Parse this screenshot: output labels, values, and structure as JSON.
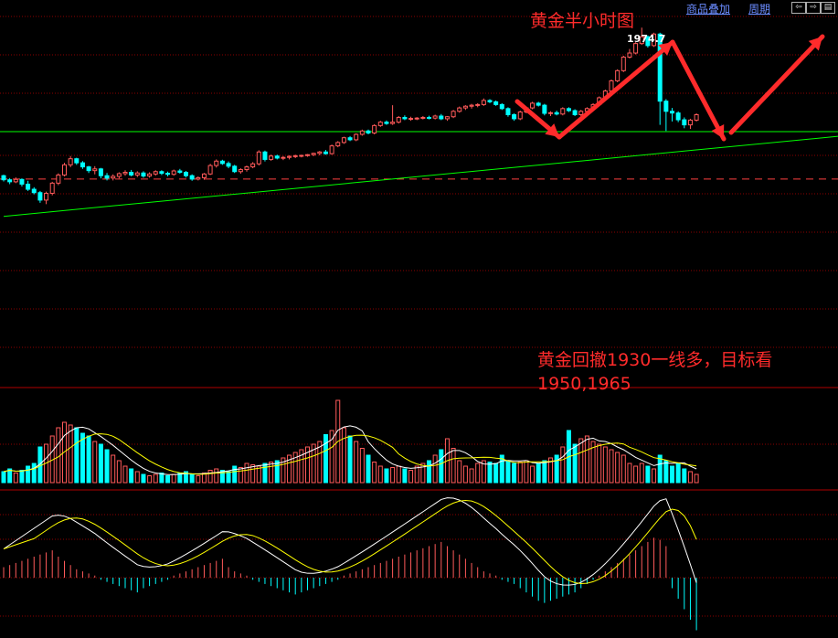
{
  "toolbar": {
    "overlay_label": "商品叠加",
    "period_label": "周期",
    "nav_icons": [
      "arrow-left-icon",
      "arrow-right-icon",
      "grid-icon"
    ]
  },
  "annotations": {
    "title": "黄金半小时图",
    "note_line1": "黄金回撤1930一线多，目标看",
    "note_line2": "1950,1965",
    "peak_label": "1974.7"
  },
  "colors": {
    "up": "#ff5a5a",
    "down": "#00ffff",
    "ma_white": "#ffffff",
    "ma_yellow": "#ffff00",
    "trendline": "#00ff00",
    "annotation_red": "#ff2b2b",
    "grid": "#8b0000"
  },
  "chart_data": [
    {
      "type": "candlestick",
      "panel": "price",
      "title": "黄金半小时图",
      "peak_label": 1974.7,
      "ylim": [
        1903,
        1978
      ],
      "grid": true,
      "resistance_dashed": 1930,
      "horizontal_green": 1944,
      "trendline": [
        [
          0,
          1919
        ],
        [
          150,
          1944.8
        ]
      ],
      "ohlc": [
        [
          1931.0,
          1931.3,
          1929.3,
          1929.8
        ],
        [
          1929.8,
          1930.3,
          1928.5,
          1929.2
        ],
        [
          1929.2,
          1930.5,
          1928.8,
          1929.9
        ],
        [
          1929.9,
          1930.2,
          1927.8,
          1928.5
        ],
        [
          1928.5,
          1929.5,
          1926.5,
          1927.0
        ],
        [
          1927.0,
          1927.6,
          1925.5,
          1926.0
        ],
        [
          1926.0,
          1926.5,
          1923.0,
          1923.8
        ],
        [
          1923.8,
          1926.3,
          1922.6,
          1925.8
        ],
        [
          1925.8,
          1929.2,
          1925.2,
          1928.8
        ],
        [
          1928.8,
          1931.7,
          1928.2,
          1931.2
        ],
        [
          1931.2,
          1934.8,
          1930.8,
          1934.2
        ],
        [
          1934.2,
          1936.8,
          1933.5,
          1936.0
        ],
        [
          1936.0,
          1936.3,
          1934.2,
          1934.8
        ],
        [
          1934.8,
          1935.3,
          1933.0,
          1933.6
        ],
        [
          1933.6,
          1933.9,
          1931.8,
          1932.5
        ],
        [
          1932.5,
          1933.8,
          1931.4,
          1933.0
        ],
        [
          1933.0,
          1933.3,
          1930.2,
          1931.0
        ],
        [
          1931.0,
          1931.8,
          1929.6,
          1930.3
        ],
        [
          1930.3,
          1931.4,
          1929.6,
          1930.8
        ],
        [
          1930.8,
          1932.0,
          1930.2,
          1931.6
        ],
        [
          1931.6,
          1932.6,
          1931.0,
          1932.0
        ],
        [
          1932.0,
          1932.7,
          1930.8,
          1931.2
        ],
        [
          1931.2,
          1932.3,
          1930.6,
          1931.8
        ],
        [
          1931.8,
          1932.3,
          1930.4,
          1930.9
        ],
        [
          1930.9,
          1932.0,
          1930.4,
          1931.5
        ],
        [
          1931.5,
          1932.6,
          1931.0,
          1932.2
        ],
        [
          1932.2,
          1932.6,
          1931.2,
          1931.7
        ],
        [
          1931.7,
          1932.2,
          1930.8,
          1931.4
        ],
        [
          1931.4,
          1932.8,
          1931.0,
          1932.4
        ],
        [
          1932.4,
          1933.0,
          1931.6,
          1932.0
        ],
        [
          1932.0,
          1932.4,
          1930.5,
          1931.0
        ],
        [
          1931.0,
          1931.4,
          1929.5,
          1930.0
        ],
        [
          1930.0,
          1930.8,
          1929.6,
          1930.4
        ],
        [
          1930.4,
          1931.8,
          1929.8,
          1931.5
        ],
        [
          1931.5,
          1934.5,
          1931.2,
          1934.0
        ],
        [
          1934.0,
          1935.8,
          1933.4,
          1935.3
        ],
        [
          1935.3,
          1935.7,
          1934.2,
          1934.6
        ],
        [
          1934.6,
          1935.2,
          1933.2,
          1933.8
        ],
        [
          1933.8,
          1934.2,
          1931.8,
          1932.2
        ],
        [
          1932.2,
          1933.2,
          1931.6,
          1932.8
        ],
        [
          1932.8,
          1934.0,
          1932.2,
          1933.6
        ],
        [
          1933.6,
          1935.0,
          1933.2,
          1934.5
        ],
        [
          1934.5,
          1938.5,
          1934.0,
          1938.0
        ],
        [
          1938.0,
          1938.4,
          1935.2,
          1935.8
        ],
        [
          1935.8,
          1937.2,
          1935.4,
          1936.8
        ],
        [
          1936.8,
          1937.2,
          1935.8,
          1936.2
        ],
        [
          1936.2,
          1936.8,
          1935.6,
          1936.4
        ],
        [
          1936.4,
          1937.0,
          1935.8,
          1936.7
        ],
        [
          1936.7,
          1937.2,
          1936.2,
          1936.9
        ],
        [
          1936.9,
          1937.2,
          1936.4,
          1937.0
        ],
        [
          1937.0,
          1937.4,
          1936.6,
          1937.2
        ],
        [
          1937.2,
          1937.8,
          1936.8,
          1937.6
        ],
        [
          1937.6,
          1938.3,
          1937.0,
          1938.0
        ],
        [
          1938.0,
          1938.6,
          1937.2,
          1937.5
        ],
        [
          1937.5,
          1940.2,
          1937.2,
          1939.8
        ],
        [
          1939.8,
          1941.2,
          1939.4,
          1940.8
        ],
        [
          1940.8,
          1942.5,
          1940.4,
          1942.2
        ],
        [
          1942.2,
          1942.7,
          1941.2,
          1941.6
        ],
        [
          1941.6,
          1943.5,
          1941.2,
          1943.2
        ],
        [
          1943.2,
          1944.6,
          1942.8,
          1944.2
        ],
        [
          1944.2,
          1944.6,
          1943.2,
          1943.6
        ],
        [
          1943.6,
          1946.2,
          1943.2,
          1945.8
        ],
        [
          1945.8,
          1947.2,
          1945.4,
          1946.8
        ],
        [
          1946.8,
          1947.3,
          1946.0,
          1946.4
        ],
        [
          1946.4,
          1951.8,
          1946.0,
          1946.8
        ],
        [
          1946.8,
          1948.6,
          1946.4,
          1948.2
        ],
        [
          1948.2,
          1948.8,
          1947.4,
          1947.8
        ],
        [
          1947.8,
          1948.4,
          1947.2,
          1947.9
        ],
        [
          1947.9,
          1948.3,
          1947.4,
          1948.0
        ],
        [
          1948.0,
          1948.6,
          1947.6,
          1948.2
        ],
        [
          1948.2,
          1948.7,
          1947.6,
          1948.0
        ],
        [
          1948.0,
          1949.0,
          1947.6,
          1948.6
        ],
        [
          1948.6,
          1949.2,
          1947.4,
          1947.8
        ],
        [
          1947.8,
          1948.6,
          1947.2,
          1948.4
        ],
        [
          1948.4,
          1950.4,
          1948.0,
          1950.0
        ],
        [
          1950.0,
          1951.4,
          1949.6,
          1951.0
        ],
        [
          1951.0,
          1951.8,
          1950.4,
          1951.5
        ],
        [
          1951.5,
          1952.2,
          1950.8,
          1951.8
        ],
        [
          1951.8,
          1952.4,
          1951.2,
          1952.0
        ],
        [
          1952.0,
          1953.8,
          1951.6,
          1953.2
        ],
        [
          1953.2,
          1953.6,
          1952.4,
          1952.8
        ],
        [
          1952.8,
          1953.2,
          1951.6,
          1952.0
        ],
        [
          1952.0,
          1952.4,
          1950.4,
          1950.8
        ],
        [
          1950.8,
          1951.2,
          1948.4,
          1949.0
        ],
        [
          1949.0,
          1949.4,
          1947.2,
          1947.8
        ],
        [
          1947.8,
          1950.2,
          1947.4,
          1949.8
        ],
        [
          1949.8,
          1951.4,
          1949.4,
          1951.0
        ],
        [
          1951.0,
          1952.8,
          1950.6,
          1952.4
        ],
        [
          1952.4,
          1952.8,
          1951.4,
          1951.8
        ],
        [
          1951.8,
          1952.2,
          1948.8,
          1949.4
        ],
        [
          1949.4,
          1950.0,
          1948.6,
          1949.6
        ],
        [
          1949.6,
          1950.2,
          1948.8,
          1949.2
        ],
        [
          1949.2,
          1951.2,
          1948.8,
          1950.8
        ],
        [
          1950.8,
          1951.2,
          1949.8,
          1950.2
        ],
        [
          1950.2,
          1950.6,
          1948.6,
          1949.0
        ],
        [
          1949.0,
          1950.4,
          1948.6,
          1950.0
        ],
        [
          1950.0,
          1951.2,
          1949.6,
          1950.8
        ],
        [
          1950.8,
          1952.4,
          1950.4,
          1952.0
        ],
        [
          1952.0,
          1954.4,
          1951.6,
          1954.0
        ],
        [
          1954.0,
          1956.4,
          1953.6,
          1956.0
        ],
        [
          1956.0,
          1959.4,
          1955.6,
          1959.0
        ],
        [
          1959.0,
          1962.4,
          1958.6,
          1962.0
        ],
        [
          1962.0,
          1966.4,
          1961.6,
          1966.0
        ],
        [
          1966.0,
          1968.4,
          1965.6,
          1967.2
        ],
        [
          1967.2,
          1970.4,
          1966.8,
          1970.0
        ],
        [
          1970.0,
          1974.7,
          1969.6,
          1972.0
        ],
        [
          1972.0,
          1972.4,
          1968.8,
          1969.4
        ],
        [
          1969.4,
          1973.2,
          1969.0,
          1972.8
        ],
        [
          1972.8,
          1973.2,
          1946.0,
          1953.0
        ],
        [
          1953.0,
          1953.6,
          1944.2,
          1950.0
        ],
        [
          1950.0,
          1951.0,
          1947.0,
          1949.5
        ],
        [
          1949.5,
          1950.0,
          1946.8,
          1947.5
        ],
        [
          1947.5,
          1948.2,
          1945.0,
          1946.0
        ],
        [
          1946.0,
          1947.8,
          1944.8,
          1947.4
        ],
        [
          1947.4,
          1949.4,
          1947.0,
          1949.0
        ]
      ],
      "moving_averages": [
        "ma_white",
        "ma_yellow"
      ]
    },
    {
      "type": "bar",
      "panel": "volume",
      "volumes": [
        8,
        10,
        7,
        9,
        12,
        14,
        26,
        28,
        34,
        40,
        44,
        42,
        40,
        36,
        34,
        30,
        28,
        24,
        20,
        16,
        12,
        10,
        8,
        6,
        5,
        6,
        7,
        5,
        6,
        7,
        8,
        6,
        5,
        7,
        9,
        10,
        9,
        8,
        12,
        11,
        14,
        13,
        12,
        14,
        15,
        16,
        18,
        20,
        22,
        24,
        26,
        28,
        30,
        35,
        38,
        60,
        40,
        34,
        30,
        25,
        20,
        15,
        12,
        10,
        11,
        12,
        10,
        9,
        12,
        14,
        16,
        20,
        24,
        32,
        25,
        16,
        12,
        10,
        14,
        16,
        15,
        14,
        20,
        16,
        14,
        15,
        16,
        12,
        14,
        16,
        18,
        20,
        26,
        38,
        28,
        32,
        34,
        30,
        28,
        26,
        24,
        22,
        20,
        14,
        12,
        14,
        12,
        10,
        20,
        16,
        12,
        14,
        10,
        8,
        6
      ],
      "moving_averages": [
        "ma_white",
        "ma_yellow"
      ]
    },
    {
      "type": "bar",
      "panel": "macd",
      "macd_hist": [
        10,
        12,
        14,
        16,
        18,
        20,
        22,
        24,
        26,
        20,
        16,
        12,
        8,
        6,
        4,
        2,
        -2,
        -4,
        -6,
        -8,
        -10,
        -12,
        -14,
        -10,
        -8,
        -6,
        -4,
        -2,
        2,
        4,
        6,
        8,
        10,
        12,
        14,
        16,
        18,
        10,
        6,
        4,
        2,
        -2,
        -4,
        -6,
        -8,
        -10,
        -12,
        -14,
        -16,
        -14,
        -12,
        -10,
        -8,
        -6,
        -4,
        -2,
        2,
        4,
        6,
        8,
        10,
        12,
        14,
        16,
        18,
        20,
        22,
        24,
        26,
        28,
        30,
        32,
        34,
        30,
        26,
        22,
        18,
        14,
        10,
        6,
        4,
        2,
        -2,
        -4,
        -6,
        -10,
        -14,
        -18,
        -22,
        -24,
        -22,
        -20,
        -18,
        -16,
        -14,
        -10,
        -6,
        -2,
        2,
        6,
        10,
        14,
        18,
        22,
        26,
        30,
        34,
        38,
        36,
        30,
        -10,
        -20,
        -30,
        -40,
        -50
      ],
      "moving_averages": [
        "ma_white",
        "ma_yellow"
      ]
    }
  ]
}
